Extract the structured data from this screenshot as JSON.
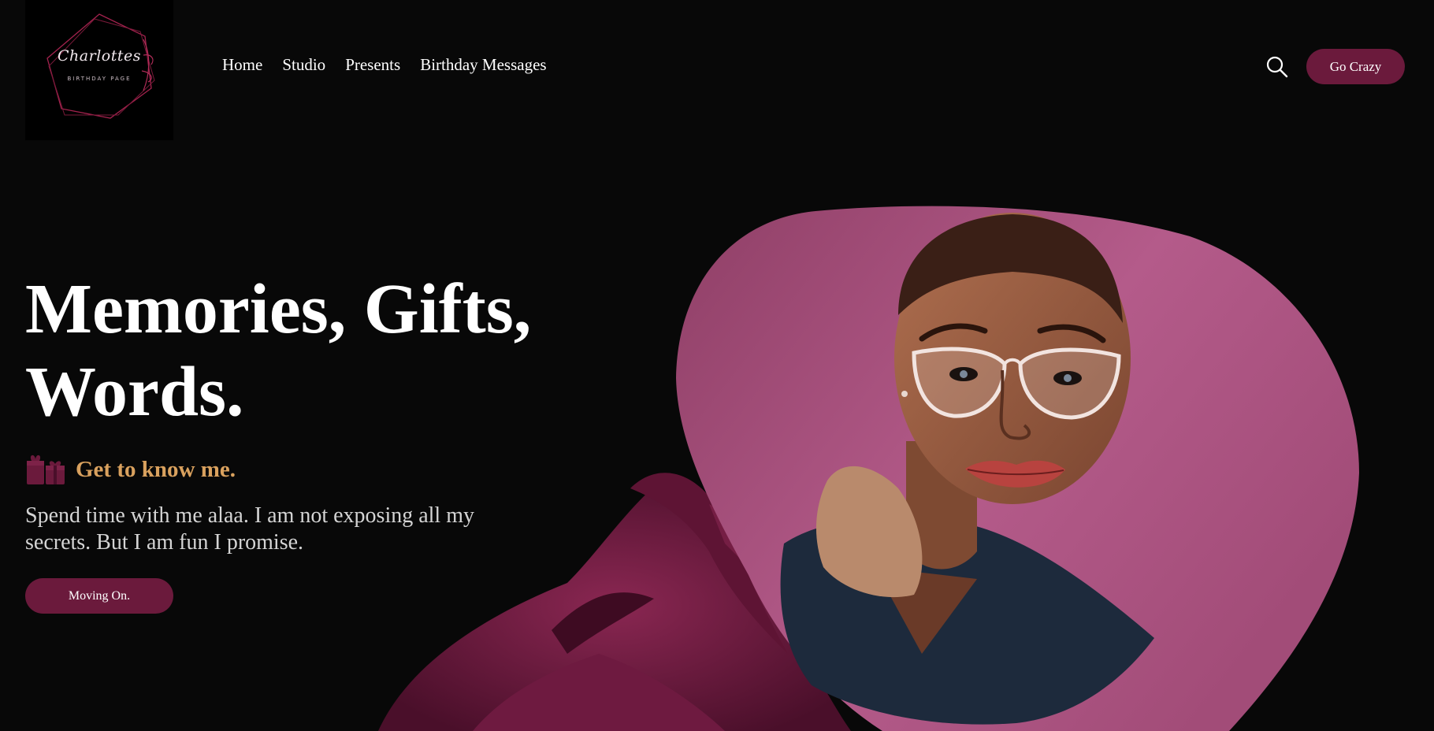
{
  "logo": {
    "title": "Charlottes",
    "subtitle": "BIRTHDAY PAGE"
  },
  "nav": {
    "items": [
      {
        "label": "Home"
      },
      {
        "label": "Studio"
      },
      {
        "label": "Presents"
      },
      {
        "label": "Birthday Messages"
      }
    ]
  },
  "header": {
    "search_icon": "search-icon",
    "cta_label": "Go Crazy"
  },
  "hero": {
    "title_line1": "Memories, Gifts,",
    "title_line2": "Words.",
    "subhead_icon": "gift-icon",
    "subhead": "Get to know me.",
    "description": "Spend time with me alaa. I am not exposing all my secrets. But I am fun I promise.",
    "cta_label": "Moving On."
  },
  "colors": {
    "background": "#080808",
    "accent": "#6b1a3c",
    "subhead": "#d9a15e",
    "blob": "#b45b8a"
  }
}
